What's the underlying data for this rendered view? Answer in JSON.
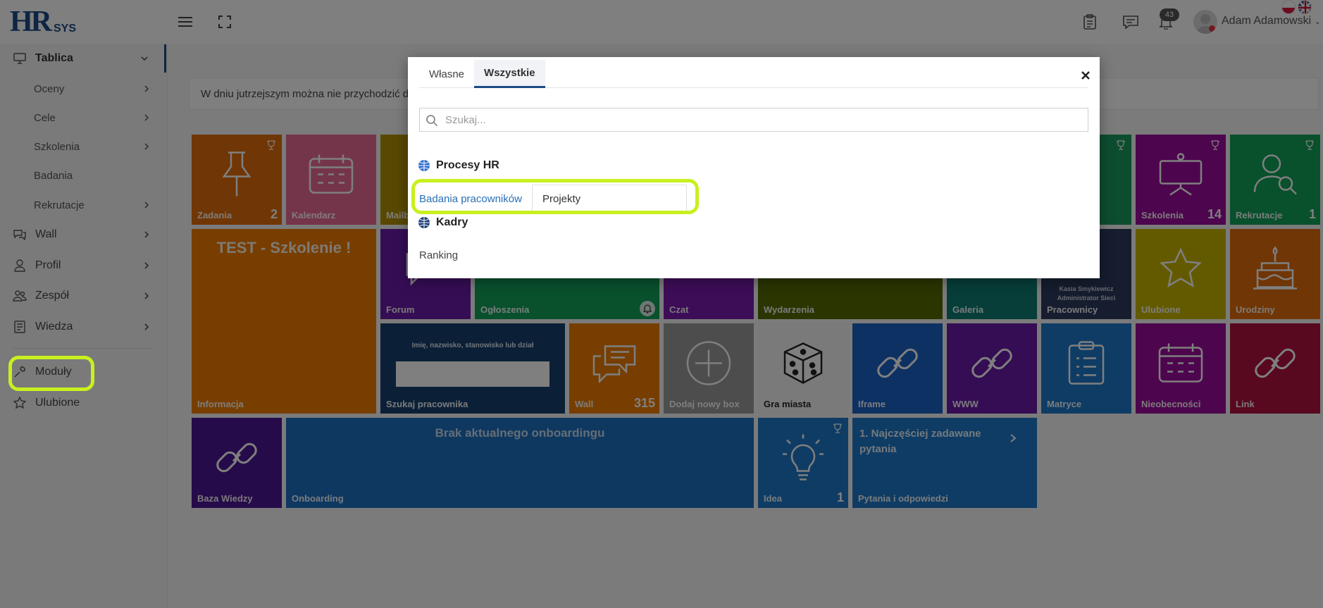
{
  "header": {
    "logo_hr": "HR",
    "logo_sys": "SYS",
    "notifications_count": "43",
    "user_name": "Adam Adamowski",
    "icons": [
      "menu-icon",
      "fullscreen-icon",
      "clipboard-icon",
      "chat-icon",
      "bell-icon",
      "chevron-down-icon"
    ]
  },
  "sidebar": {
    "items": [
      {
        "label": "Tablica",
        "icon": "monitor-icon"
      },
      {
        "label": "Oceny"
      },
      {
        "label": "Cele"
      },
      {
        "label": "Szkolenia"
      },
      {
        "label": "Badania"
      },
      {
        "label": "Rekrutacje"
      },
      {
        "label": "Wall",
        "icon": "comments-icon"
      },
      {
        "label": "Profil",
        "icon": "user-icon"
      },
      {
        "label": "Zespół",
        "icon": "team-icon"
      },
      {
        "label": "Wiedza",
        "icon": "book-icon"
      },
      {
        "label": "Moduły",
        "icon": "wrench-icon"
      },
      {
        "label": "Ulubione",
        "icon": "star-icon"
      }
    ]
  },
  "main": {
    "notice": "W dniu jutrzejszym można nie przychodzić do"
  },
  "tiles": {
    "zadania": {
      "label": "Zadania",
      "count": "2"
    },
    "kalendarz": {
      "label": "Kalendarz"
    },
    "mail": {
      "label": "Mailb"
    },
    "szkolenia": {
      "label": "Szkolenia",
      "count": "14"
    },
    "rekrutacje": {
      "label": "Rekrutacje",
      "count": "1"
    },
    "informacja": {
      "label": "Informacja",
      "title": "TEST - Szkolenie !"
    },
    "forum": {
      "label": "Forum"
    },
    "ogloszenia": {
      "label": "Ogłoszenia"
    },
    "czat": {
      "label": "Czat"
    },
    "wydarzenia": {
      "label": "Wydarzenia"
    },
    "galeria": {
      "label": "Galeria"
    },
    "pracownicy": {
      "label": "Pracownicy",
      "person": "Kasia Smykiewicz",
      "role": "Administrator Sieci"
    },
    "ulubione": {
      "label": "Ulubione"
    },
    "urodziny": {
      "label": "Urodziny"
    },
    "szukaj": {
      "label": "Szukaj pracownika",
      "hint": "Imię, nazwisko, stanowisko lub dział"
    },
    "wall": {
      "label": "Wall",
      "count": "315"
    },
    "dodaj": {
      "label": "Dodaj nowy box"
    },
    "gra": {
      "label": "Gra miasta"
    },
    "iframe": {
      "label": "Iframe"
    },
    "www": {
      "label": "WWW"
    },
    "matryce": {
      "label": "Matryce"
    },
    "nieobecnosci": {
      "label": "Nieobecności"
    },
    "link": {
      "label": "Link"
    },
    "baza": {
      "label": "Baza Wiedzy"
    },
    "onboarding": {
      "label": "Onboarding",
      "title": "Brak aktualnego onboardingu"
    },
    "idea": {
      "label": "Idea",
      "count": "1"
    },
    "pytania": {
      "label": "Pytania i odpowiedzi",
      "title": "1. Najczęściej zadawane pytania"
    }
  },
  "modal": {
    "tabs": [
      {
        "label": "Własne"
      },
      {
        "label": "Wszystkie",
        "active": true
      }
    ],
    "search_placeholder": "Szukaj...",
    "groups": [
      {
        "title": "Procesy HR",
        "links": [
          "Badania pracowników",
          "Projekty"
        ]
      },
      {
        "title": "Kadry",
        "links": [
          "Ranking"
        ]
      }
    ]
  },
  "colors": {
    "brand": "#1d4a86",
    "highlight": "#c8f01f",
    "link": "#2a6fb5",
    "tile_orange": "#e06c0b",
    "tile_orange2": "#ef7d00",
    "tile_pink": "#e86b94",
    "tile_olive": "#b39100",
    "tile_purple": "#6a1aa8",
    "tile_green": "#12a05a",
    "tile_violet": "#7a1ab0",
    "tile_darkolive": "#556b00",
    "tile_teal": "#0e7c72",
    "tile_navy": "#2a3a5c",
    "tile_yellow": "#c7b400",
    "tile_blue": "#1f78c8",
    "tile_navyblue": "#17406e",
    "tile_grey": "#9a9a9a",
    "tile_white": "#f5f5f5",
    "tile_royal": "#1a63c4",
    "tile_magenta": "#9b0d9a",
    "tile_crimson": "#b0103f",
    "tile_indigo": "#4d1794",
    "tile_emerald": "#1b9a5e",
    "tile_ocean": "#1e70c0"
  }
}
